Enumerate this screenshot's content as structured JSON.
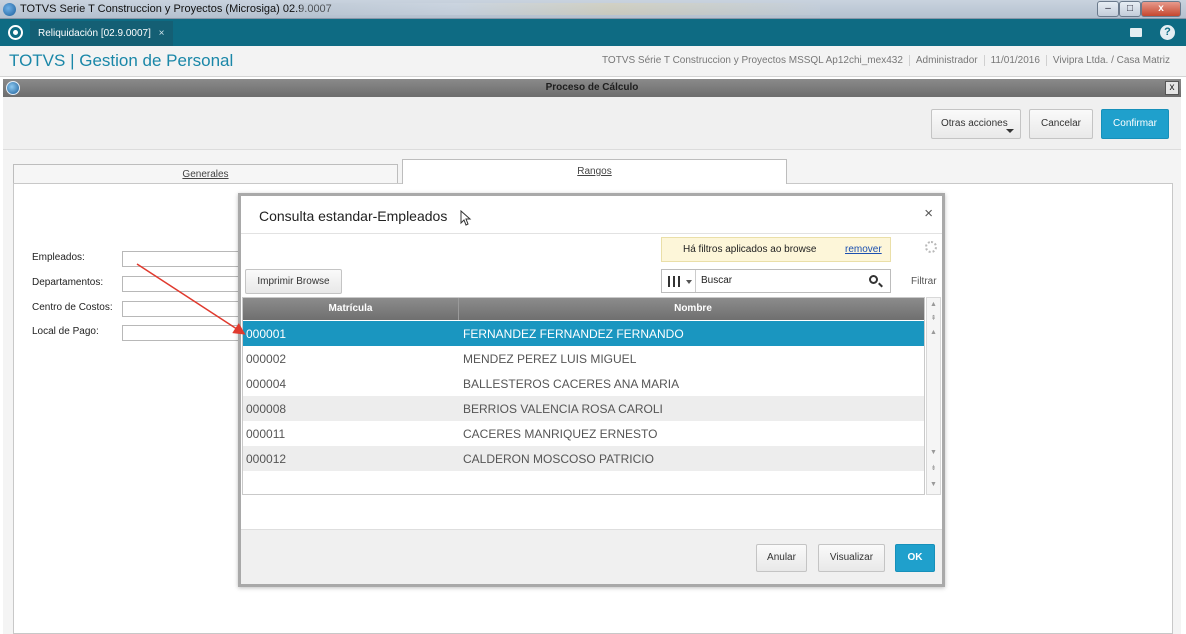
{
  "window": {
    "title": "TOTVS Serie T Construccion y Proyectos (Microsiga) 02.9.0007",
    "min_label": "–",
    "max_label": "□",
    "close_label": "x"
  },
  "tab_bar": {
    "active_tab": "Reliquidación [02.9.0007]",
    "tab_close": "×",
    "help_label": "?"
  },
  "header": {
    "brand": "TOTVS | Gestion de Personal",
    "environment": "TOTVS Série T Construccion y Proyectos MSSQL Ap12chi_mex432",
    "user": "Administrador",
    "date": "11/01/2016",
    "company": "Vivipra Ltda. / Casa Matriz"
  },
  "process": {
    "title": "Proceso de Cálculo",
    "close_label": "x"
  },
  "actions": {
    "otras": "Otras acciones",
    "cancelar": "Cancelar",
    "confirmar": "Confirmar"
  },
  "tabs": {
    "generales": "Generales",
    "rangos": "Rangos"
  },
  "form": {
    "empleados": "Empleados:",
    "departamentos": "Departamentos:",
    "centro": "Centro de Costos:",
    "local": "Local de Pago:"
  },
  "dialog": {
    "title": "Consulta estandar-Empleados",
    "close": "×",
    "filter_notice": "Há filtros aplicados ao browse",
    "filter_remove": "remover",
    "print_button": "Imprimir Browse",
    "search_placeholder": "Buscar",
    "filter_label": "Filtrar",
    "columns": [
      "Matrícula",
      "Nombre"
    ],
    "rows": [
      {
        "mat": "000001",
        "nom": "FERNANDEZ FERNANDEZ FERNANDO"
      },
      {
        "mat": "000002",
        "nom": "MENDEZ PEREZ LUIS MIGUEL"
      },
      {
        "mat": "000004",
        "nom": "BALLESTEROS CACERES ANA MARIA"
      },
      {
        "mat": "000008",
        "nom": "BERRIOS VALENCIA ROSA CAROLI"
      },
      {
        "mat": "000011",
        "nom": "CACERES MANRIQUEZ ERNESTO"
      },
      {
        "mat": "000012",
        "nom": "CALDERON MOSCOSO PATRICIO"
      }
    ],
    "anular": "Anular",
    "visualizar": "Visualizar",
    "ok": "OK"
  },
  "colors": {
    "accent": "#1fa0cc",
    "tab_bar": "#0e6b83",
    "selected_row": "#1a96c0",
    "annotation_arrow": "#e03a2e"
  }
}
